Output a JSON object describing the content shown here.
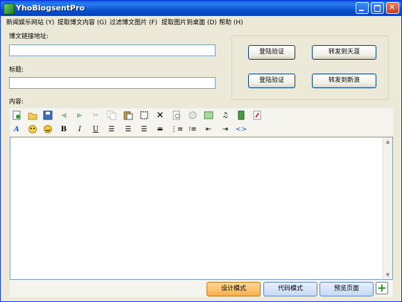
{
  "window": {
    "title": "YhoBlogsentPro"
  },
  "menu": [
    "新闻娱乐网站 (Y)",
    "提取博文内容 (G)",
    "过滤博文图片 (F)",
    "提取图片到桌面 (D)",
    "帮助 (H)"
  ],
  "form": {
    "url_label": "博文链接地址:",
    "url_value": "",
    "title_label": "标题:",
    "title_value": "",
    "content_label": "内容:"
  },
  "actions": {
    "login_verify_1": "登陆验证",
    "forward_tianya": "转发到天涯",
    "login_verify_2": "登陆验证",
    "forward_sina": "转发到新浪"
  },
  "editor_modes": {
    "design": "设计模式",
    "code": "代码模式",
    "preview": "预览页面"
  },
  "toolbar_row1": [
    "new-doc-icon",
    "open-folder-icon",
    "save-icon",
    "undo-icon",
    "redo-icon",
    "cut-icon",
    "copy-icon",
    "paste-icon",
    "select-all-icon",
    "delete-icon",
    "find-icon",
    "link-icon",
    "image-icon",
    "audio-icon",
    "video-icon",
    "flash-icon"
  ],
  "toolbar_row2": [
    "font-style-icon",
    "emoticon-icon",
    "smiley-icon",
    "bold-icon",
    "italic-icon",
    "underline-icon",
    "align-left-icon",
    "align-center-icon",
    "align-right-icon",
    "strikethrough-icon",
    "ordered-list-icon",
    "unordered-list-icon",
    "outdent-icon",
    "indent-icon",
    "code-view-icon"
  ],
  "colors": {
    "accent_orange": "#f7b04a",
    "title_blue": "#0a5ddc",
    "window_bg": "#ece9d8"
  }
}
